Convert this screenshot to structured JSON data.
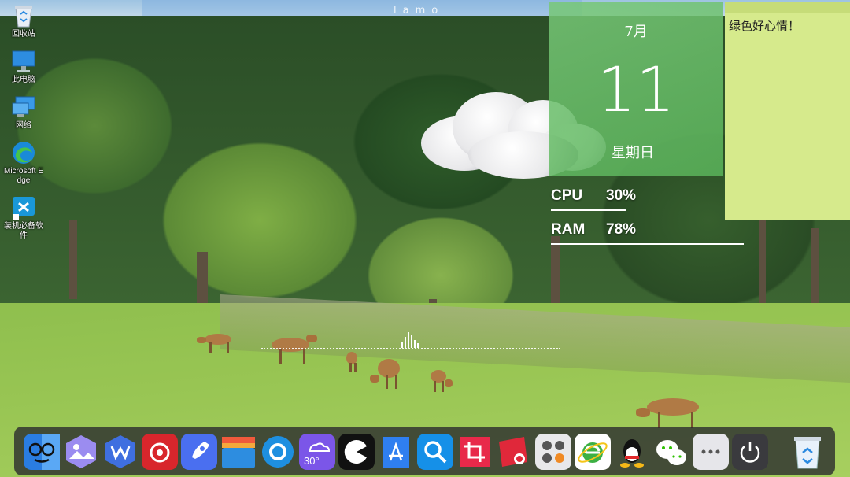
{
  "wallpaper": {
    "watermark": "lamo"
  },
  "desktop": {
    "icons": [
      {
        "name": "recycle-bin",
        "label": "回收站"
      },
      {
        "name": "this-pc",
        "label": "此电脑"
      },
      {
        "name": "network",
        "label": "网络"
      },
      {
        "name": "edge",
        "label": "Microsoft Edge"
      },
      {
        "name": "installer",
        "label": "装机必备软件"
      }
    ]
  },
  "calendar": {
    "month": "7月",
    "day": "11",
    "weekday": "星期日"
  },
  "note": {
    "text": "绿色好心情！"
  },
  "system": {
    "cpu": {
      "label": "CPU",
      "value": "30%",
      "fraction": 0.3
    },
    "ram": {
      "label": "RAM",
      "value": "78%",
      "fraction": 0.78
    }
  },
  "dock": {
    "items": [
      {
        "name": "finder-face-icon",
        "color": "#2a7de1"
      },
      {
        "name": "photos-icon",
        "color": "#7a6be0"
      },
      {
        "name": "wps-icon",
        "color": "#3f6fe0"
      },
      {
        "name": "netease-music-icon",
        "color": "#d8262c"
      },
      {
        "name": "rocket-launcher-icon",
        "color": "#4a6ff0"
      },
      {
        "name": "folder-icon",
        "color": "#2d8de0"
      },
      {
        "name": "settings-gear-icon",
        "color": "#1e8fe0"
      },
      {
        "name": "weather-icon",
        "color": "#7b56e8",
        "text": "30°"
      },
      {
        "name": "pacman-icon",
        "color": "#111111"
      },
      {
        "name": "app-store-icon",
        "color": "#2f7ff0"
      },
      {
        "name": "search-icon",
        "color": "#1590e8"
      },
      {
        "name": "crop-icon",
        "color": "#e8294a"
      },
      {
        "name": "screen-record-icon",
        "color": "#e0283a"
      },
      {
        "name": "calculator-icon",
        "color": "#e8e8ea"
      },
      {
        "name": "ie-browser-icon",
        "color": "#ffffff"
      },
      {
        "name": "qq-icon",
        "color": "#222222"
      },
      {
        "name": "wechat-icon",
        "color": "#ffffff"
      },
      {
        "name": "more-icon",
        "color": "#e6e6ea"
      },
      {
        "name": "power-icon",
        "color": "#3a3a3e"
      },
      {
        "name": "recycle-bin-icon",
        "color": "#e8f1fb"
      }
    ]
  }
}
